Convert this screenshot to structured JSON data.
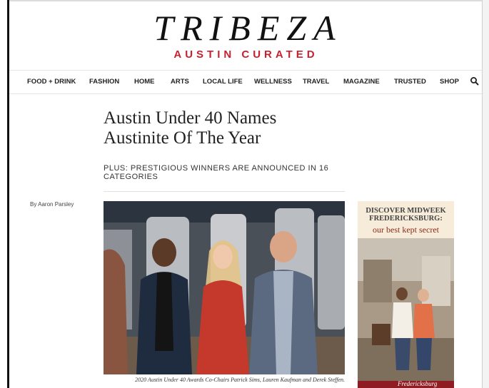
{
  "site": {
    "logo": "TRIBEZA",
    "tagline": "AUSTIN CURATED"
  },
  "nav": {
    "items": [
      "FOOD + DRINK",
      "FASHION",
      "HOME",
      "ARTS",
      "LOCAL LIFE",
      "WELLNESS",
      "TRAVEL",
      "MAGAZINE",
      "TRUSTED",
      "SHOP"
    ],
    "search_icon": "search-icon"
  },
  "article": {
    "headline_line1": "Austin Under 40 Names",
    "headline_line2": "Austinite Of The Year",
    "subhead": "PLUS: PRESTIGIOUS WINNERS ARE ANNOUNCED IN 16 CATEGORIES",
    "byline": "By Aaron Parsley",
    "caption": "2020 Austin Under 40 Awards Co-Chairs Patrick Sims, Lauren Kaufman and Derek Steffen."
  },
  "ad": {
    "headline_line1": "DISCOVER MIDWEEK",
    "headline_line2": "FREDERICKSBURG:",
    "tagline": "our best kept secret",
    "brand": "Fredericksburg"
  },
  "colors": {
    "accent_red": "#c8202e",
    "ad_maroon": "#8e1c22",
    "text": "#222222"
  }
}
